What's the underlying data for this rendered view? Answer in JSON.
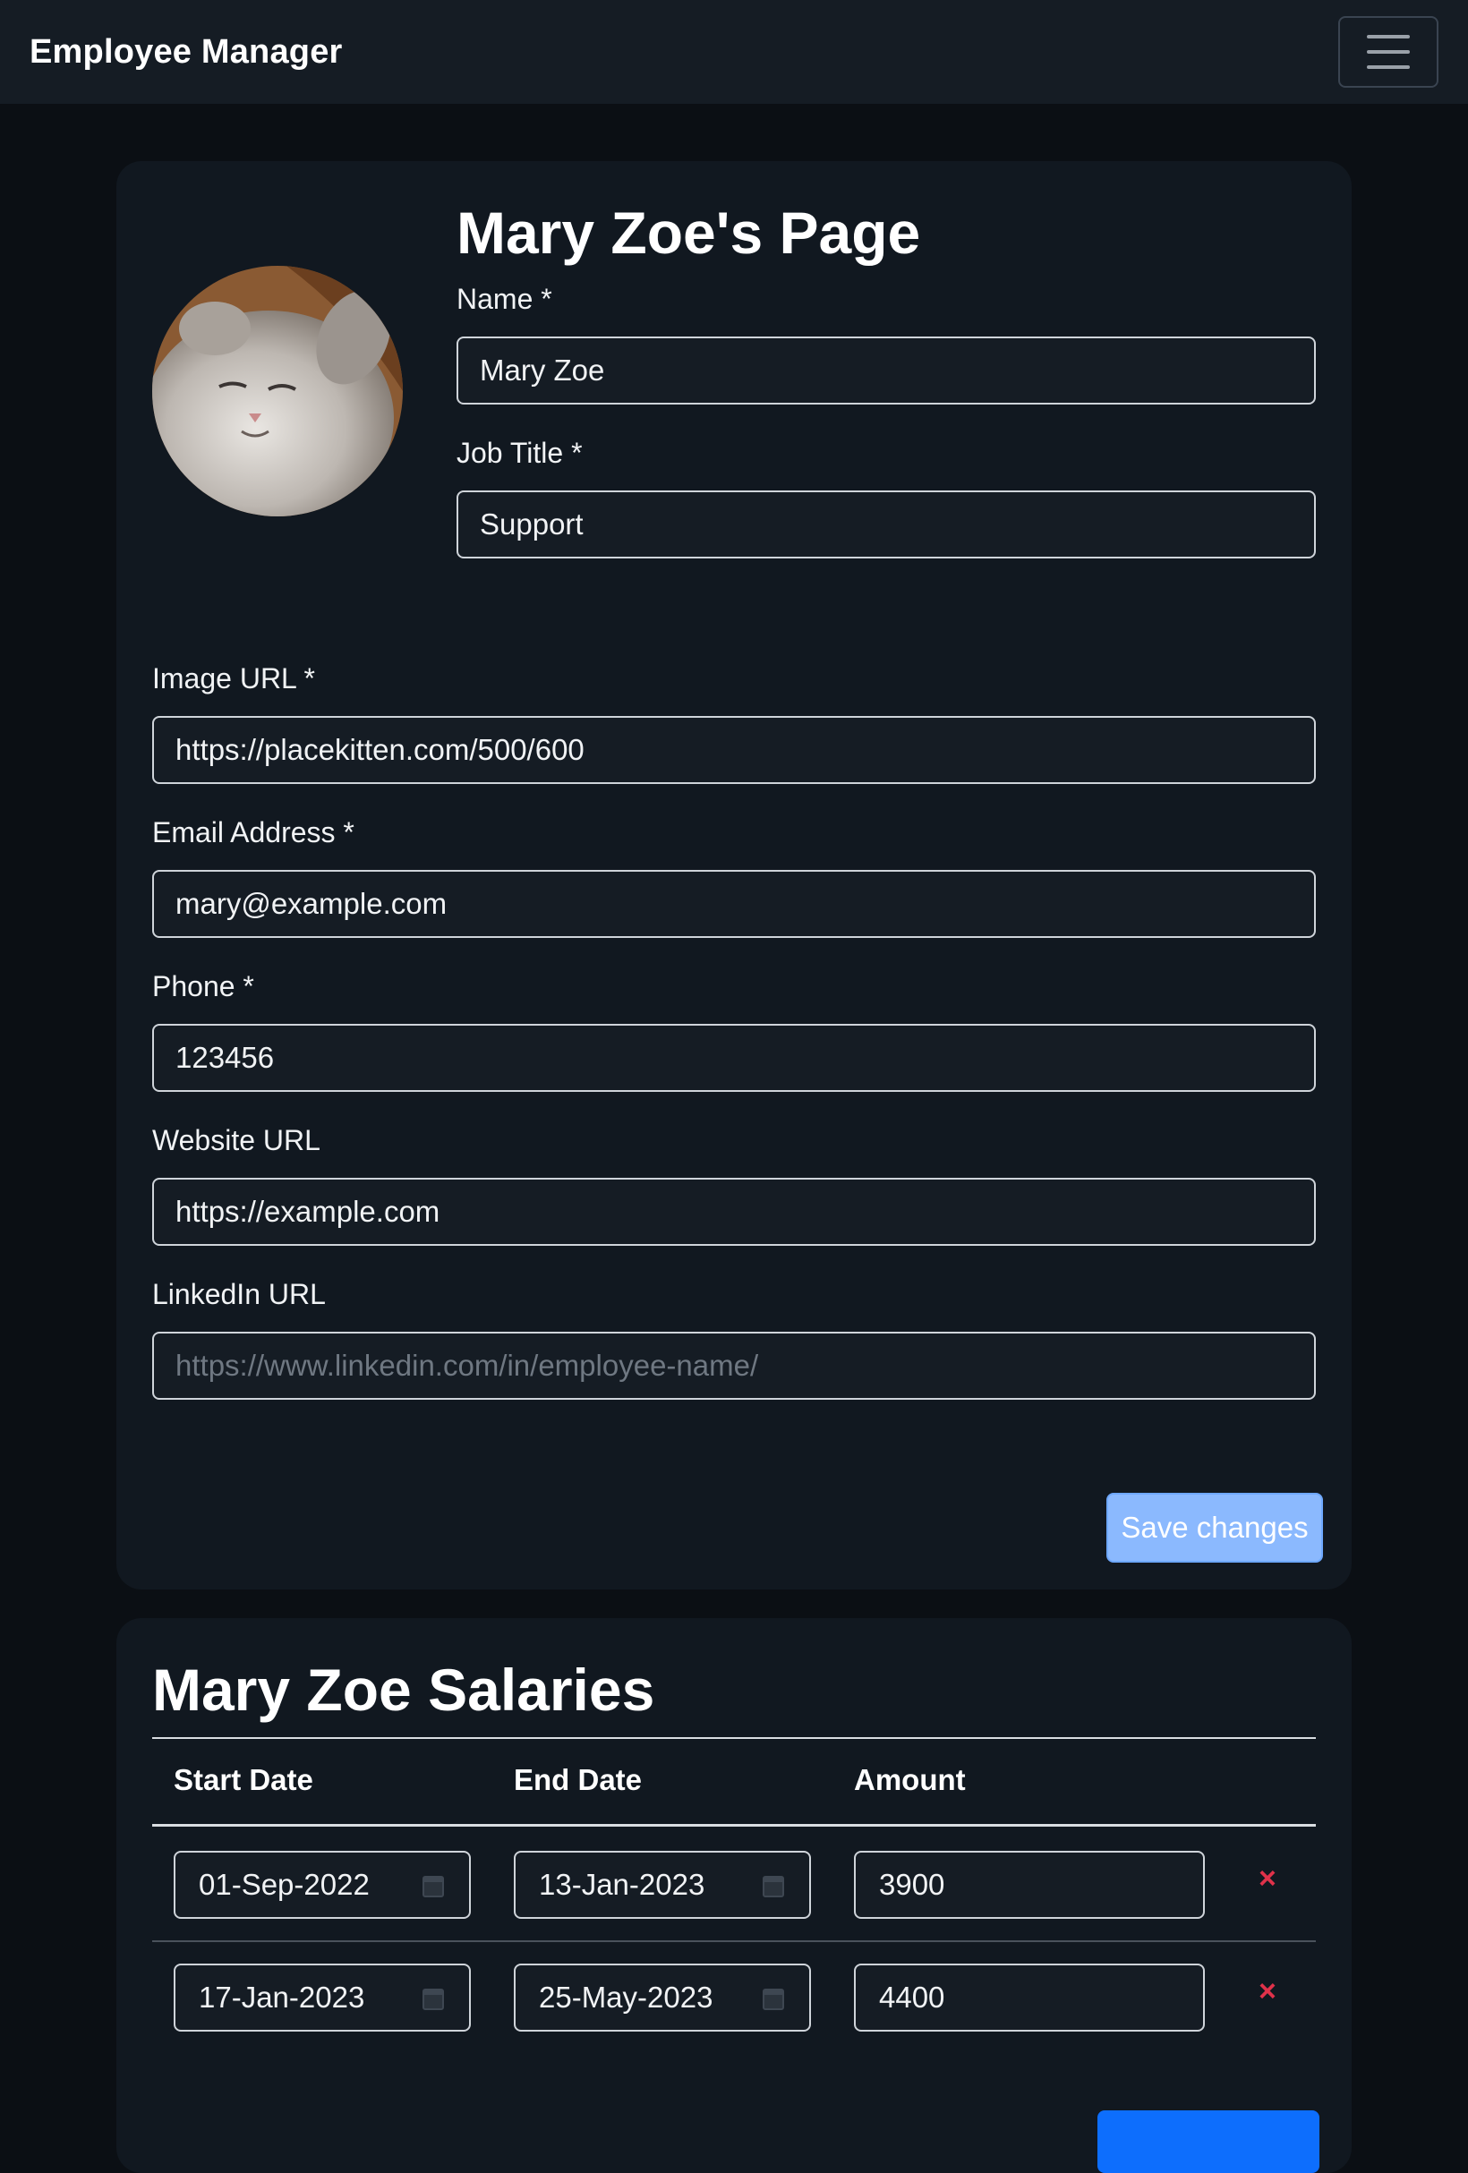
{
  "navbar": {
    "brand": "Employee Manager",
    "menu_icon": "hamburger-menu-icon"
  },
  "profile": {
    "title": "Mary Zoe's Page",
    "avatar_alt": "kitten photo",
    "fields": {
      "name": {
        "label": "Name *",
        "value": "Mary Zoe"
      },
      "job": {
        "label": "Job Title *",
        "value": "Support"
      },
      "image": {
        "label": "Image URL *",
        "value": "https://placekitten.com/500/600"
      },
      "email": {
        "label": "Email Address *",
        "value": "mary@example.com"
      },
      "phone": {
        "label": "Phone *",
        "value": "123456"
      },
      "website": {
        "label": "Website URL",
        "value": "https://example.com"
      },
      "linkedin": {
        "label": "LinkedIn URL",
        "value": "",
        "placeholder": "https://www.linkedin.com/in/employee-name/"
      }
    },
    "save_label": "Save changes"
  },
  "salaries": {
    "title": "Mary Zoe Salaries",
    "columns": [
      "Start Date",
      "End Date",
      "Amount"
    ],
    "rows": [
      {
        "start": "01-Sep-2022",
        "end": "13-Jan-2023",
        "amount": "3900",
        "delete_icon": "×"
      },
      {
        "start": "17-Jan-2023",
        "end": "25-May-2023",
        "amount": "4400",
        "delete_icon": "×"
      }
    ]
  },
  "colors": {
    "accent": "#0d6efd",
    "save_button": "#8bb9fe",
    "delete": "#e0324a",
    "background": "#0b0f14",
    "card": "#111820"
  }
}
